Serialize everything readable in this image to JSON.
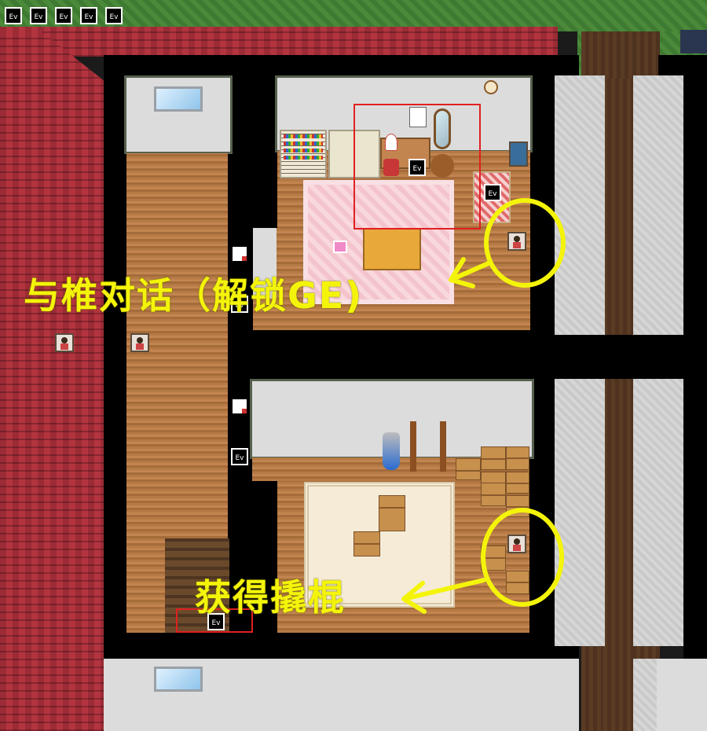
{
  "toolbar": {
    "event_markers": [
      "Ev",
      "Ev",
      "Ev",
      "Ev",
      "Ev"
    ]
  },
  "map": {
    "event_label": "Ev"
  },
  "annotations": {
    "talk_label": "与椎对话（解锁GE)",
    "obtain_label": "获得撬棍",
    "highlight_color": "#f4f40a",
    "selection_color": "#e02020"
  }
}
